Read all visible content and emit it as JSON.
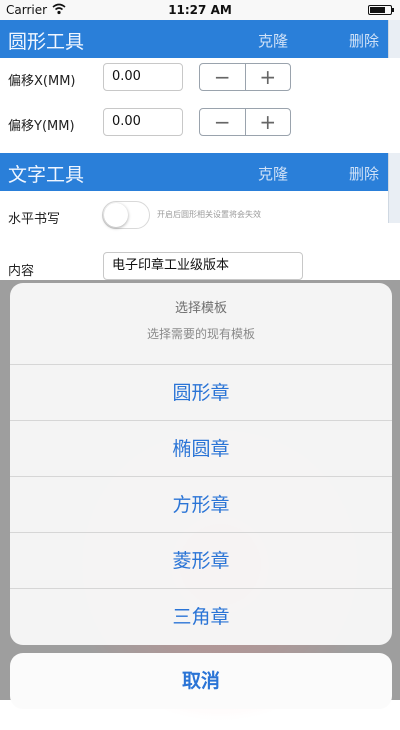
{
  "status_bar": {
    "carrier": "Carrier",
    "time": "11:27 AM"
  },
  "circle_tool": {
    "title": "圆形工具",
    "clone_label": "克隆",
    "delete_label": "删除",
    "offset_x": {
      "label": "偏移X(MM)",
      "value": "0.00"
    },
    "offset_y": {
      "label": "偏移Y(MM)",
      "value": "0.00"
    },
    "stepper": {
      "minus": "−",
      "plus": "+"
    }
  },
  "text_tool": {
    "title": "文字工具",
    "clone_label": "克隆",
    "delete_label": "删除",
    "horizontal_label": "水平书写",
    "toggle_hint": "开启后圆形相关设置将会失效",
    "content_label": "内容",
    "content_value": "电子印章工业级版本"
  },
  "action_sheet": {
    "title": "选择模板",
    "message": "选择需要的现有模板",
    "options": [
      "圆形章",
      "椭圆章",
      "方形章",
      "菱形章",
      "三角章"
    ],
    "cancel": "取消"
  },
  "colors": {
    "header_blue": "#2a7fd9",
    "action_blue": "#2a74d6"
  }
}
